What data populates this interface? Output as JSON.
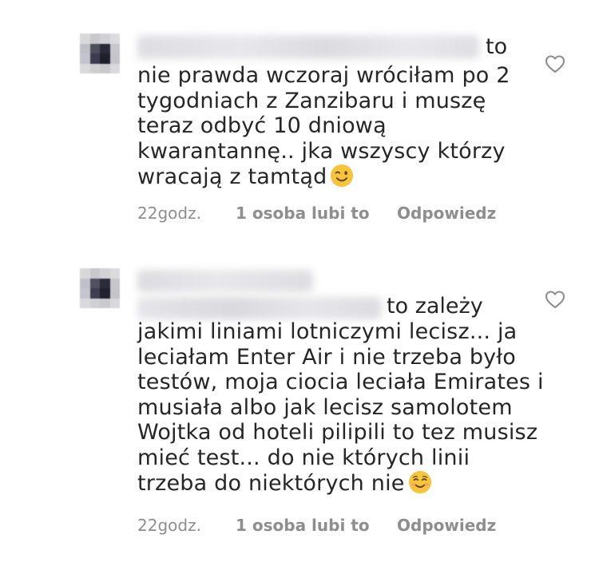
{
  "comments": [
    {
      "text_tail": "to",
      "lines": [
        "nie prawda wczoraj wróciłam po 2",
        "tygodniach z Zanzibaru i muszę",
        "teraz odbyć 10 dniową",
        "kwarantannę.. jka wszyscy którzy",
        "wracają z tamtąd"
      ],
      "emoji": "winking-face",
      "time": "22godz.",
      "likes": "1 osoba lubi to",
      "reply_label": "Odpowiedz"
    },
    {
      "text_tail": "to zależy",
      "lines": [
        "jakimi liniami lotniczymi lecisz... ja",
        "leciałam Enter Air i nie trzeba było",
        "testów, moja ciocia leciała Emirates i",
        "musiała albo jak lecisz samolotem",
        "Wojtka od hoteli pilipili to tez musisz",
        "mieć test... do nie których linii",
        "trzeba do niektórych nie"
      ],
      "emoji": "smiling-face",
      "time": "22godz.",
      "likes": "1 osoba lubi to",
      "reply_label": "Odpowiedz"
    }
  ],
  "colors": {
    "text": "#262626",
    "meta": "#8e8e8e",
    "heart": "#8e8e8e",
    "emoji": "#f7c43d"
  }
}
